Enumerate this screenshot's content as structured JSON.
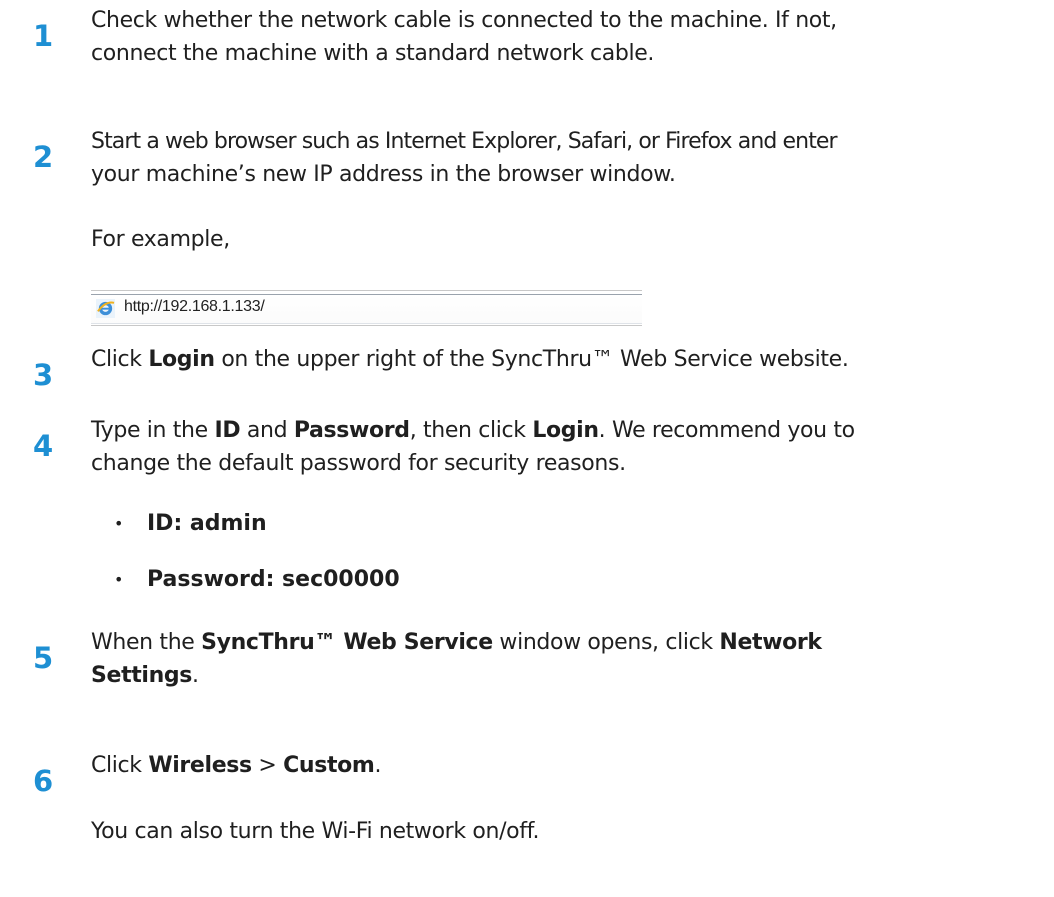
{
  "steps": [
    {
      "number": "1",
      "line1": "Check whether the network cable is connected to the machine. If not,",
      "line2": "connect the machine with a standard network cable."
    },
    {
      "number": "2",
      "line1": "Start a web browser such as Internet Explorer, Safari, or Firefox and enter",
      "line2": "your machine’s new IP address in the browser window.",
      "extra": "For example,"
    },
    {
      "number": "3",
      "pre": "Click ",
      "bold1": "Login",
      "post": " on the upper right of the SyncThru™ Web Service website."
    },
    {
      "number": "4",
      "pre": "Type in the ",
      "bold1": "ID",
      "mid1": " and ",
      "bold2": "Password",
      "mid2": ", then click ",
      "bold3": "Login",
      "post": ". We recommend you to",
      "line2": "change the default password for security reasons.",
      "bullets": [
        "ID: admin",
        "Password: sec00000"
      ]
    },
    {
      "number": "5",
      "pre": "When the ",
      "bold1": "SyncThru™ Web Service",
      "mid1": " window opens, click ",
      "bold2": "Network",
      "line2_bold": "Settings",
      "line2_post": "."
    },
    {
      "number": "6",
      "pre": "Click ",
      "bold1": "Wireless",
      "mid1": " > ",
      "bold2": "Custom",
      "post": ".",
      "extra": "You can also turn the Wi-Fi network on/off."
    }
  ],
  "address_bar": {
    "url": "http://192.168.1.133/",
    "icon": "ie-icon"
  },
  "bullet_glyph": "•"
}
